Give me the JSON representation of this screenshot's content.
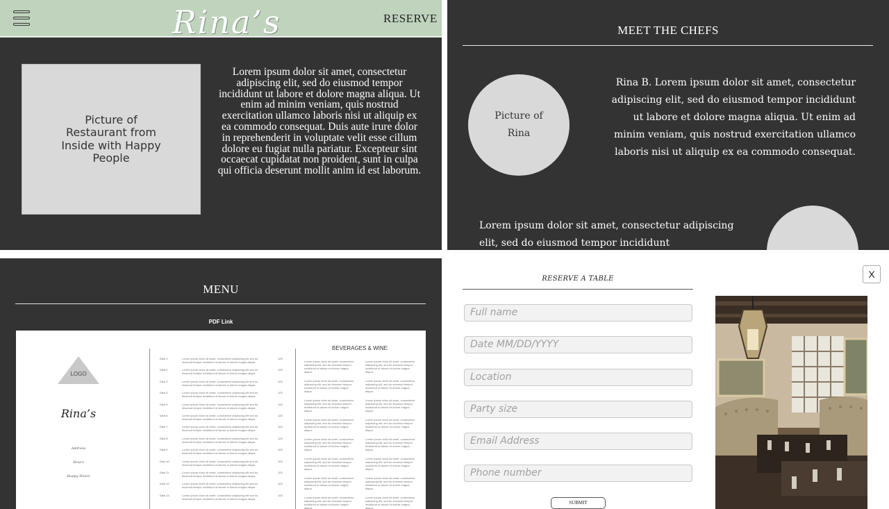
{
  "home": {
    "brand": "Rina’s",
    "reserve_label": "RESERVE",
    "photo_placeholder": "Picture of Restaurant from Inside with Happy People",
    "intro_text": "Lorem ipsum dolor sit amet, consectetur adipiscing elit, sed do eiusmod tempor incididunt ut labore et dolore magna aliqua. Ut enim ad minim veniam, quis nostrud exercitation ullamco laboris nisi ut aliquip ex ea commodo consequat. Duis aute irure dolor in reprehenderit in voluptate velit esse cillum dolore eu fugiat nulla pariatur. Excepteur sint occaecat cupidatat non proident, sunt in culpa qui officia deserunt mollit anim id est laborum.",
    "colors": {
      "header": "#bfd3bd",
      "background": "#333333"
    }
  },
  "chefs": {
    "title": "MEET THE CHEFS",
    "chef1_placeholder": "Picture of Rina",
    "chef1_bio": "Rina B. Lorem ipsum dolor sit amet, consectetur adipiscing elit, sed do eiusmod tempor incididunt ut labore et dolore magna aliqua. Ut enim ad minim veniam, quis nostrud exercitation ullamco laboris nisi ut aliquip ex ea commodo consequat.",
    "chef2_bio": "Lorem ipsum dolor sit amet, consectetur adipiscing elit, sed do eiusmod tempor incididunt"
  },
  "menu": {
    "title": "MENU",
    "pdf_link": "PDF Link",
    "logo": "LOGO",
    "brand": "Rina’s",
    "meta": [
      "Address",
      "Hours",
      "Happy Hours"
    ],
    "dishes": [
      {
        "name": "Dish 1",
        "price": "123"
      },
      {
        "name": "Dish 2",
        "price": "123"
      },
      {
        "name": "Dish 3",
        "price": "123"
      },
      {
        "name": "Dish 4",
        "price": "123"
      },
      {
        "name": "Dish 5",
        "price": "123"
      },
      {
        "name": "Dish 6",
        "price": "123"
      },
      {
        "name": "Dish 7",
        "price": "123"
      },
      {
        "name": "Dish 8",
        "price": "123"
      },
      {
        "name": "Dish 9",
        "price": "123"
      },
      {
        "name": "Dish 10",
        "price": "123"
      },
      {
        "name": "Dish 11",
        "price": "123"
      },
      {
        "name": "Dish 12",
        "price": "123"
      },
      {
        "name": "Dish 13",
        "price": "123"
      }
    ],
    "dish_desc": "Lorem ipsum dolor sit amet, consectetur adipiscing elit sed do eiusmod tempor incididunt ut labore et dolore magna aliqua",
    "beverages_title": "BEVERAGES & WINE",
    "bev_desc": "Lorem ipsum dolor sit amet, consectetur adipiscing elit, sed do eiusmod tempor incididunt ut labore et dolore magna aliqua."
  },
  "reserve": {
    "close_label": "X",
    "title": "RESERVE A TABLE",
    "fields": {
      "full_name": "Full name",
      "date": "Date MM/DD/YYYY",
      "location": "Location",
      "party_size": "Party size",
      "email": "Email Address",
      "phone": "Phone number"
    },
    "submit_label": "SUBMIT"
  }
}
